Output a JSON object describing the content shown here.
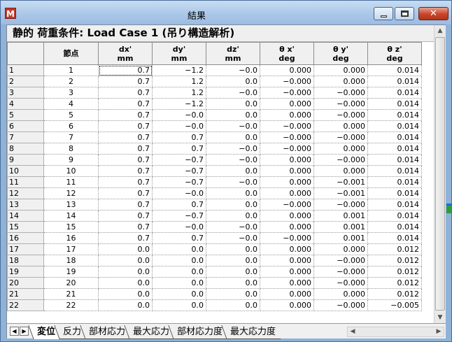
{
  "window": {
    "app_icon_letter": "M",
    "title": "結果",
    "close_glyph": "✕"
  },
  "caption": "静的 荷重条件: Load Case 1 (吊り構造解析)",
  "table": {
    "columns": [
      {
        "top": "節点",
        "bottom": ""
      },
      {
        "top": "dx'",
        "bottom": "mm"
      },
      {
        "top": "dy'",
        "bottom": "mm"
      },
      {
        "top": "dz'",
        "bottom": "mm"
      },
      {
        "top": "θ x'",
        "bottom": "deg"
      },
      {
        "top": "θ y'",
        "bottom": "deg"
      },
      {
        "top": "θ z'",
        "bottom": "deg"
      }
    ],
    "rows": [
      [
        "1",
        "1",
        "0.7",
        "−1.2",
        "−0.0",
        "0.000",
        "0.000",
        "0.014"
      ],
      [
        "2",
        "2",
        "0.7",
        "1.2",
        "0.0",
        "−0.000",
        "0.000",
        "0.014"
      ],
      [
        "3",
        "3",
        "0.7",
        "1.2",
        "−0.0",
        "−0.000",
        "−0.000",
        "0.014"
      ],
      [
        "4",
        "4",
        "0.7",
        "−1.2",
        "0.0",
        "0.000",
        "−0.000",
        "0.014"
      ],
      [
        "5",
        "5",
        "0.7",
        "−0.0",
        "0.0",
        "0.000",
        "−0.000",
        "0.014"
      ],
      [
        "6",
        "6",
        "0.7",
        "−0.0",
        "−0.0",
        "−0.000",
        "0.000",
        "0.014"
      ],
      [
        "7",
        "7",
        "0.7",
        "0.7",
        "0.0",
        "−0.000",
        "−0.000",
        "0.014"
      ],
      [
        "8",
        "8",
        "0.7",
        "0.7",
        "−0.0",
        "−0.000",
        "0.000",
        "0.014"
      ],
      [
        "9",
        "9",
        "0.7",
        "−0.7",
        "−0.0",
        "0.000",
        "−0.000",
        "0.014"
      ],
      [
        "10",
        "10",
        "0.7",
        "−0.7",
        "0.0",
        "0.000",
        "0.000",
        "0.014"
      ],
      [
        "11",
        "11",
        "0.7",
        "−0.7",
        "−0.0",
        "0.000",
        "−0.001",
        "0.014"
      ],
      [
        "12",
        "12",
        "0.7",
        "−0.0",
        "0.0",
        "0.000",
        "−0.001",
        "0.014"
      ],
      [
        "13",
        "13",
        "0.7",
        "0.7",
        "0.0",
        "−0.000",
        "−0.000",
        "0.014"
      ],
      [
        "14",
        "14",
        "0.7",
        "−0.7",
        "0.0",
        "0.000",
        "0.001",
        "0.014"
      ],
      [
        "15",
        "15",
        "0.7",
        "−0.0",
        "−0.0",
        "0.000",
        "0.001",
        "0.014"
      ],
      [
        "16",
        "16",
        "0.7",
        "0.7",
        "−0.0",
        "−0.000",
        "0.001",
        "0.014"
      ],
      [
        "17",
        "17",
        "0.0",
        "0.0",
        "0.0",
        "0.000",
        "0.000",
        "0.012"
      ],
      [
        "18",
        "18",
        "0.0",
        "0.0",
        "0.0",
        "0.000",
        "−0.000",
        "0.012"
      ],
      [
        "19",
        "19",
        "0.0",
        "0.0",
        "0.0",
        "0.000",
        "−0.000",
        "0.012"
      ],
      [
        "20",
        "20",
        "0.0",
        "0.0",
        "0.0",
        "0.000",
        "−0.000",
        "0.012"
      ],
      [
        "21",
        "21",
        "0.0",
        "0.0",
        "0.0",
        "0.000",
        "0.000",
        "0.012"
      ],
      [
        "22",
        "22",
        "0.0",
        "0.0",
        "0.0",
        "0.000",
        "−0.000",
        "−0.005"
      ]
    ]
  },
  "tabs": [
    "変位",
    "反力",
    "部材応力",
    "最大応力",
    "部材応力度",
    "最大応力度"
  ],
  "active_tab": 0,
  "nav": {
    "prev": "◀",
    "next": "▶"
  },
  "scroll": {
    "up": "▲",
    "down": "▼",
    "left": "◀",
    "right": "▶"
  }
}
